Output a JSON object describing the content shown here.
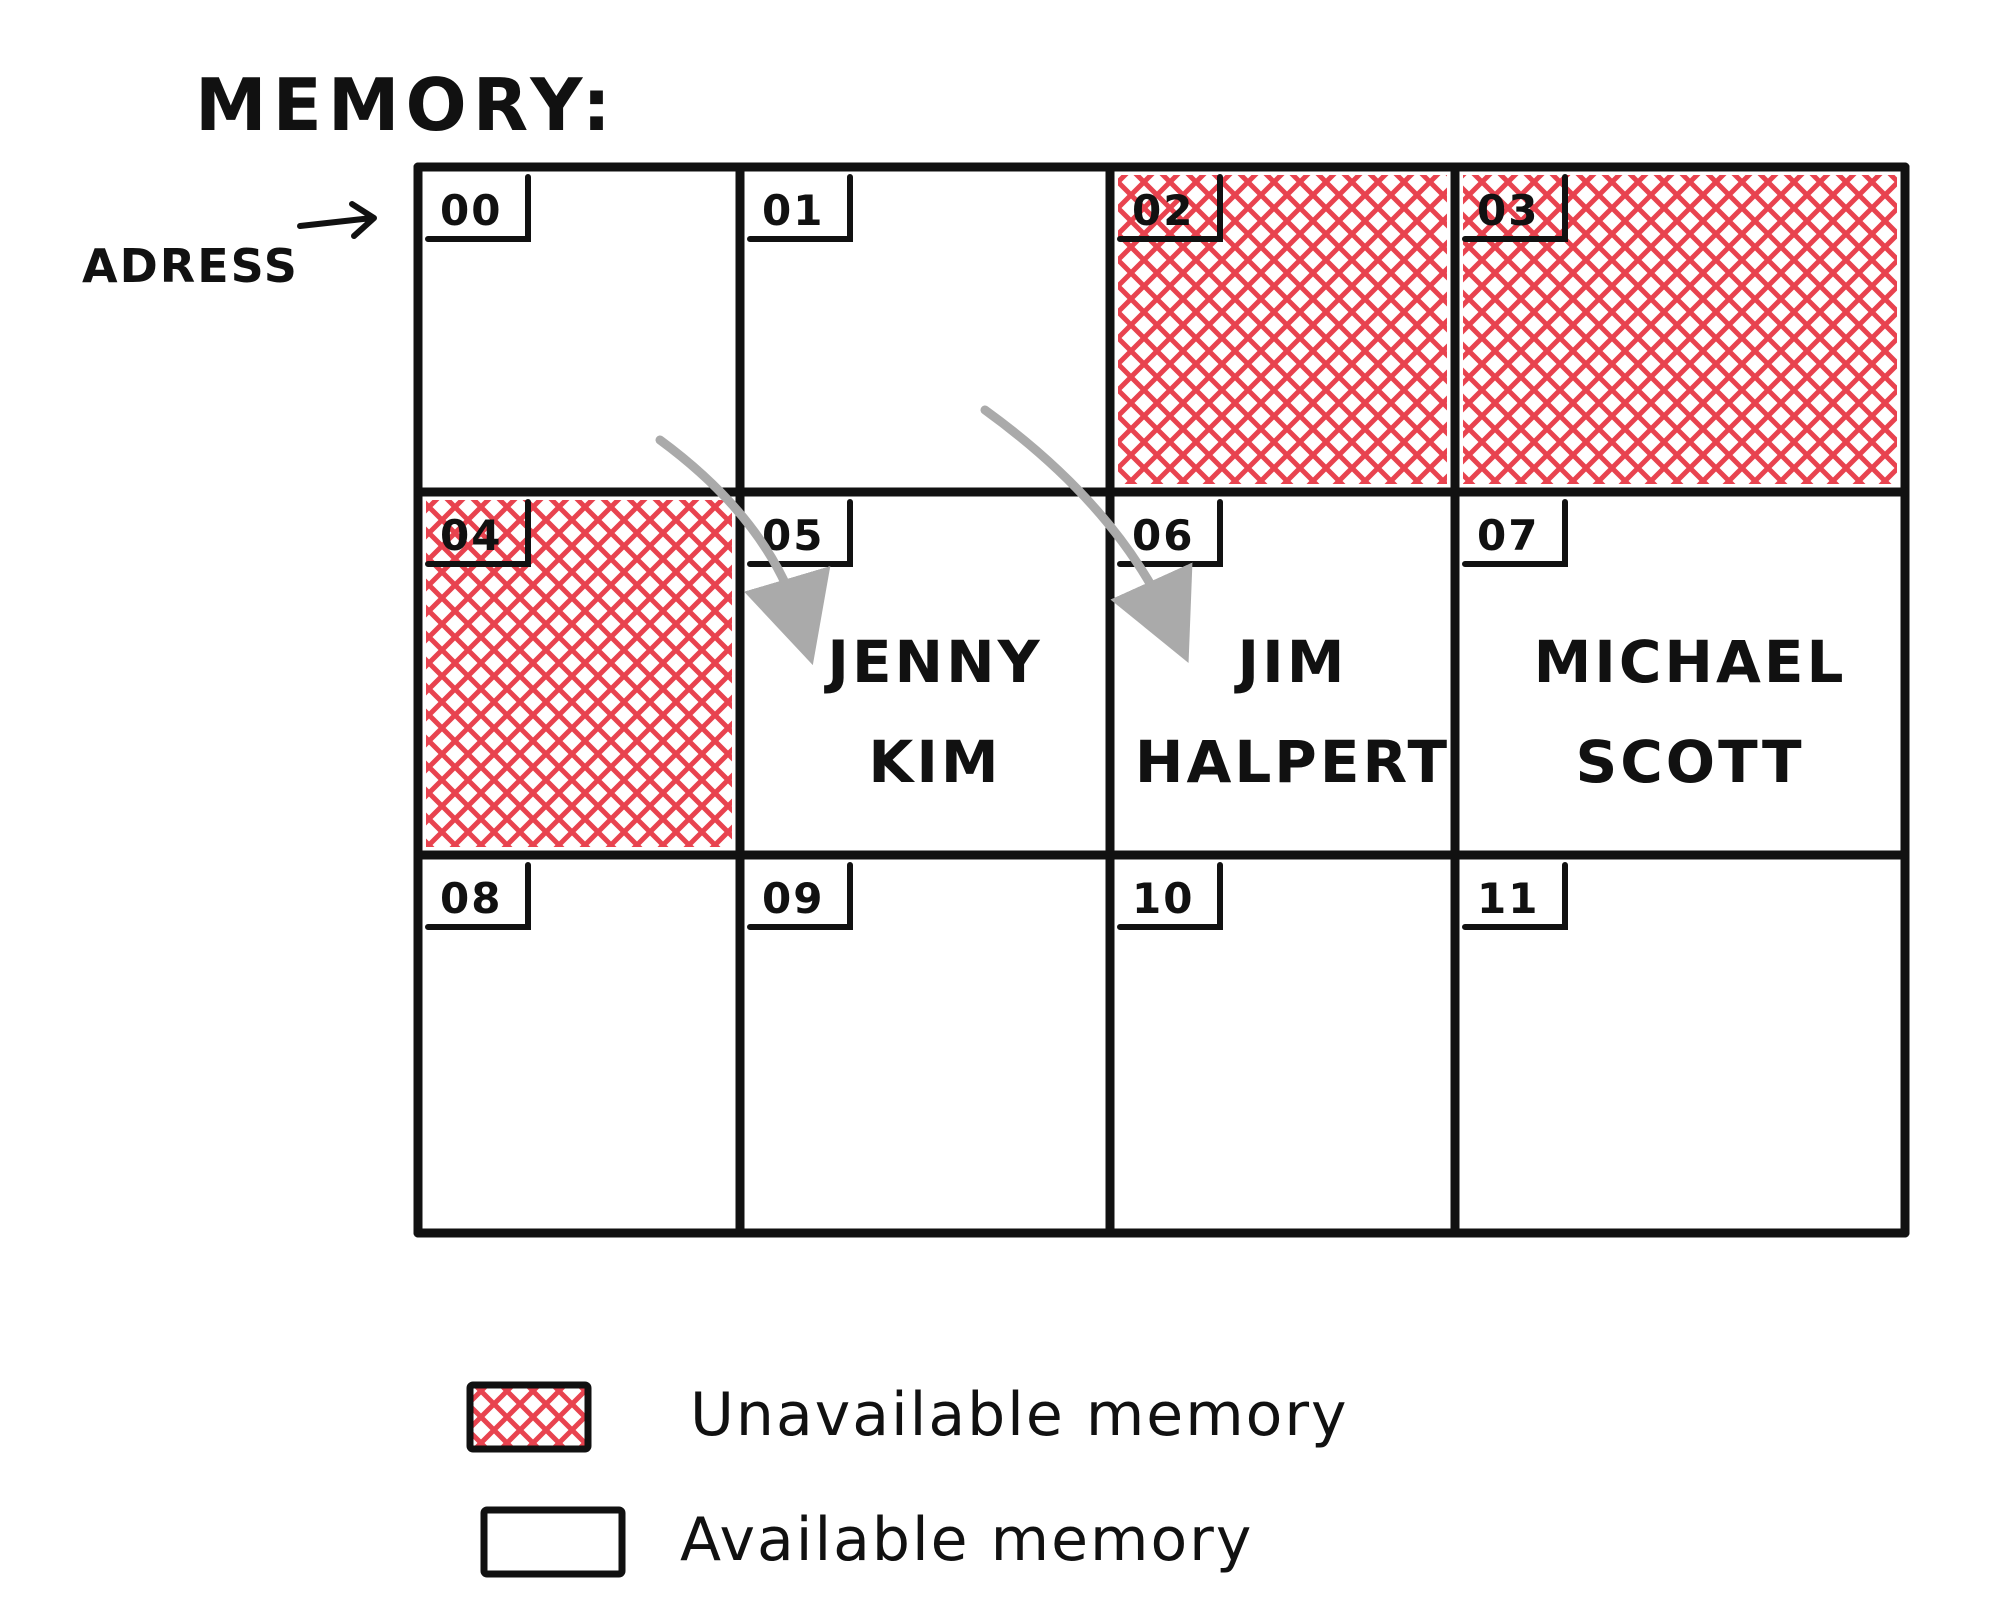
{
  "title": "MEMORY:",
  "address_label": "ADRESS",
  "colors": {
    "ink": "#111111",
    "unavailable": "#e8434f",
    "pointer": "#aaaaaa",
    "background": "#ffffff"
  },
  "cells": [
    {
      "address": "00",
      "status": "available",
      "lines": []
    },
    {
      "address": "01",
      "status": "available",
      "lines": []
    },
    {
      "address": "02",
      "status": "unavailable",
      "lines": []
    },
    {
      "address": "03",
      "status": "unavailable",
      "lines": []
    },
    {
      "address": "04",
      "status": "unavailable",
      "lines": []
    },
    {
      "address": "05",
      "status": "available",
      "lines": [
        "JENNY",
        "KIM"
      ]
    },
    {
      "address": "06",
      "status": "available",
      "lines": [
        "JIM",
        "HALPERT"
      ]
    },
    {
      "address": "07",
      "status": "available",
      "lines": [
        "MICHAEL",
        "SCOTT"
      ]
    },
    {
      "address": "08",
      "status": "available",
      "lines": []
    },
    {
      "address": "09",
      "status": "available",
      "lines": []
    },
    {
      "address": "10",
      "status": "available",
      "lines": []
    },
    {
      "address": "11",
      "status": "available",
      "lines": []
    }
  ],
  "legend": [
    {
      "label": "Unavailable memory",
      "status": "unavailable"
    },
    {
      "label": "Available memory",
      "status": "available"
    }
  ]
}
